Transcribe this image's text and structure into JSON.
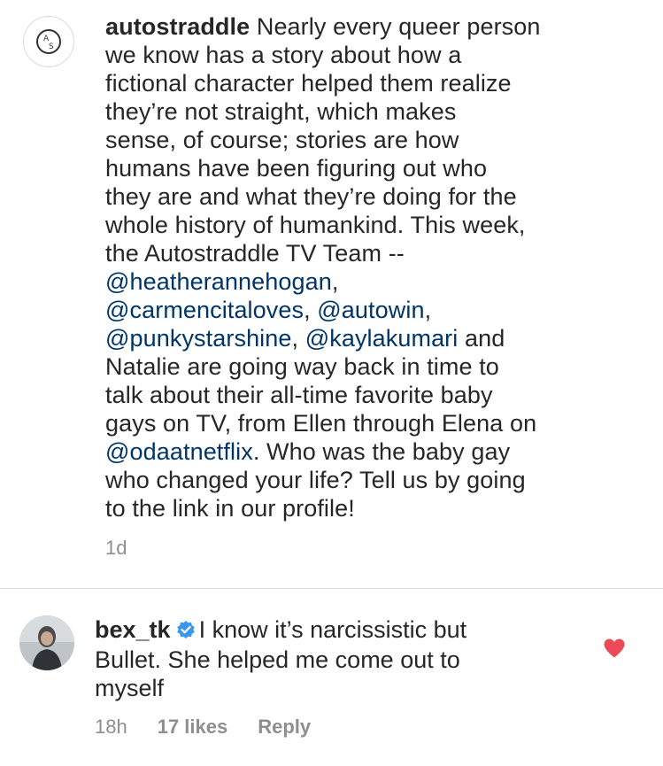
{
  "post": {
    "username": "autostraddle",
    "avatar_icon": "autostraddle-logo-icon",
    "lines": [
      [
        {
          "t": "Nearly every queer person",
          "m": false
        }
      ],
      [
        {
          "t": "we know has a story about how a",
          "m": false
        }
      ],
      [
        {
          "t": "fictional character helped them realize",
          "m": false
        }
      ],
      [
        {
          "t": "they’re not straight, which makes",
          "m": false
        }
      ],
      [
        {
          "t": "sense, of course; stories are how",
          "m": false
        }
      ],
      [
        {
          "t": "humans have been figuring out who",
          "m": false
        }
      ],
      [
        {
          "t": "they are and what they’re doing for the",
          "m": false
        }
      ],
      [
        {
          "t": "whole history of humankind. This week,",
          "m": false
        }
      ],
      [
        {
          "t": "the Autostraddle TV Team --",
          "m": false
        }
      ],
      [
        {
          "t": "@heatheranne​hogan",
          "m": true
        },
        {
          "t": ",",
          "m": false
        }
      ],
      [
        {
          "t": "@carmencitaloves",
          "m": true
        },
        {
          "t": ", ",
          "m": false
        },
        {
          "t": "@autowin",
          "m": true
        },
        {
          "t": ",",
          "m": false
        }
      ],
      [
        {
          "t": "@punkystarshine",
          "m": true
        },
        {
          "t": ", ",
          "m": false
        },
        {
          "t": "@kaylakumari",
          "m": true
        },
        {
          "t": " and",
          "m": false
        }
      ],
      [
        {
          "t": "Natalie are going way back in time to",
          "m": false
        }
      ],
      [
        {
          "t": "talk about their all-time favorite baby",
          "m": false
        }
      ],
      [
        {
          "t": "gays on TV, from Ellen through Elena on",
          "m": false
        }
      ],
      [
        {
          "t": "@odaatnetflix",
          "m": true
        },
        {
          "t": ". Who was the baby gay",
          "m": false
        }
      ],
      [
        {
          "t": "who changed your life? Tell us by going",
          "m": false
        }
      ],
      [
        {
          "t": "to the link in our profile!",
          "m": false
        }
      ]
    ],
    "time": "1d"
  },
  "comment": {
    "username": "bex_tk",
    "verified_icon": "verified-badge-icon",
    "lines": [
      "I know it’s narcissistic but",
      "Bullet. She helped me come out to",
      "myself"
    ],
    "time": "18h",
    "likes": "17 likes",
    "reply": "Reply",
    "heart_icon": "heart-icon",
    "heart_color": "#ed4956"
  },
  "colors": {
    "text": "#262626",
    "mention": "#003569",
    "muted": "#8e8e8e",
    "divider": "#dbdbdb",
    "verified": "#3897f0"
  }
}
